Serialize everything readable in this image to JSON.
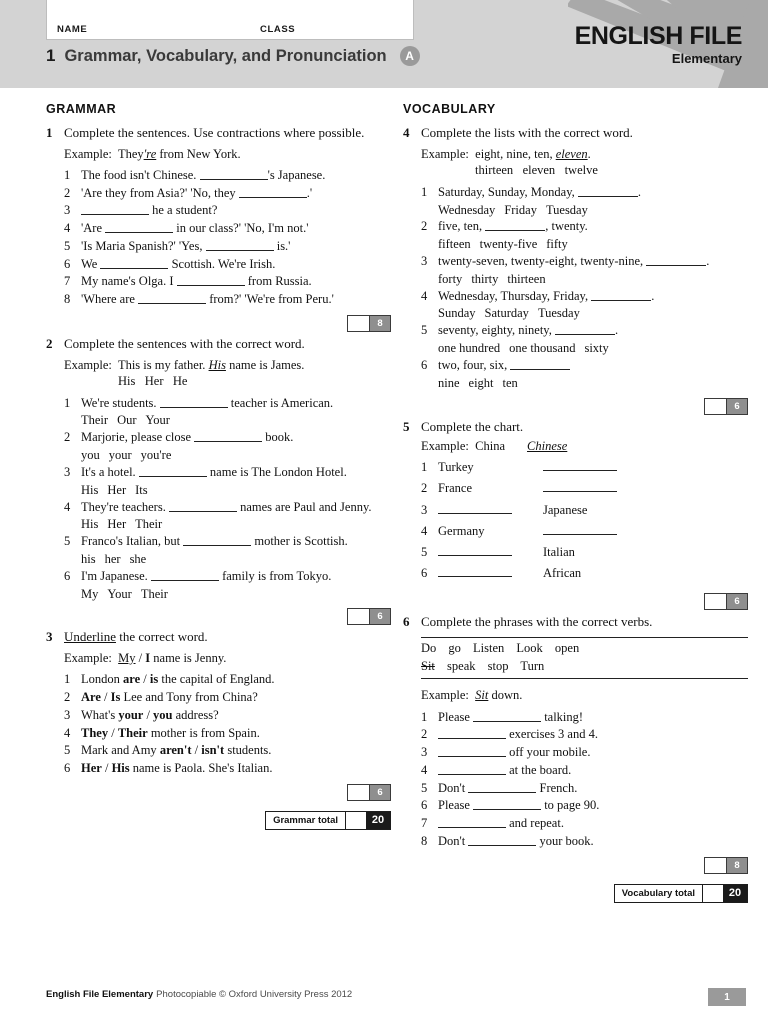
{
  "header": {
    "name_label": "NAME",
    "class_label": "CLASS",
    "unit_number": "1",
    "title": "Grammar, Vocabulary, and Pronunciation",
    "version_badge": "A",
    "brand_line1": "ENGLISH FILE",
    "brand_line2": "Elementary",
    "colors": {
      "header_bg": "#d3d3d3",
      "ray": "#a9a9a9",
      "badge": "#9a9a9a"
    }
  },
  "grammar": {
    "section_label": "GRAMMAR",
    "total_label": "Grammar total",
    "total_value": "20",
    "exercises": [
      {
        "number": "1",
        "instruction": "Complete the sentences. Use contractions where possible.",
        "example_lead": "Example:",
        "example_pre": "They",
        "example_answer": "'re",
        "example_post": " from New York.",
        "score": "8",
        "items": [
          {
            "n": "1",
            "pre": "The food isn't Chinese. ",
            "post": "'s Japanese."
          },
          {
            "n": "2",
            "pre": "'Are they from Asia?'    'No, they ",
            "post": ".'"
          },
          {
            "n": "3",
            "pre": "",
            "post": " he a student?"
          },
          {
            "n": "4",
            "pre": "'Are ",
            "post": " in our class?'    'No, I'm not.'"
          },
          {
            "n": "5",
            "pre": "'Is Maria Spanish?'    'Yes, ",
            "post": " is.'"
          },
          {
            "n": "6",
            "pre": "We ",
            "post": " Scottish. We're Irish."
          },
          {
            "n": "7",
            "pre": "My name's Olga. I ",
            "post": " from Russia."
          },
          {
            "n": "8",
            "pre": "'Where are ",
            "post": " from?'    'We're from Peru.'"
          }
        ]
      },
      {
        "number": "2",
        "instruction": "Complete the sentences with the correct word.",
        "example_lead": "Example:",
        "example_pre": "This is my father. ",
        "example_answer": "His",
        "example_post": " name is James.",
        "example_options": [
          "His",
          "Her",
          "He"
        ],
        "score": "6",
        "items": [
          {
            "n": "1",
            "pre": "We're students. ",
            "post": " teacher is American.",
            "options": [
              "Their",
              "Our",
              "Your"
            ]
          },
          {
            "n": "2",
            "pre": "Marjorie, please close ",
            "post": " book.",
            "options": [
              "you",
              "your",
              "you're"
            ]
          },
          {
            "n": "3",
            "pre": "It's a hotel. ",
            "post": " name is The London Hotel.",
            "options": [
              "His",
              "Her",
              "Its"
            ]
          },
          {
            "n": "4",
            "pre": "They're teachers. ",
            "post": " names are Paul and Jenny.",
            "options": [
              "His",
              "Her",
              "Their"
            ]
          },
          {
            "n": "5",
            "pre": "Franco's Italian, but ",
            "post": " mother is Scottish.",
            "options": [
              "his",
              "her",
              "she"
            ]
          },
          {
            "n": "6",
            "pre": "I'm Japanese. ",
            "post": " family is from Tokyo.",
            "options": [
              "My",
              "Your",
              "Their"
            ]
          }
        ]
      },
      {
        "number": "3",
        "instruction_underlined": "Underline",
        "instruction_rest": " the correct word.",
        "example_lead": "Example:",
        "example_answer": "My",
        "example_alt": "I",
        "example_post": " name is Jenny.",
        "score": "6",
        "items": [
          {
            "n": "1",
            "pre": "London ",
            "a": "are",
            "b": "is",
            "post": " the capital of England."
          },
          {
            "n": "2",
            "pre": "",
            "a": "Are",
            "b": "Is",
            "post": " Lee and Tony from China?"
          },
          {
            "n": "3",
            "pre": "What's ",
            "a": "your",
            "b": "you",
            "post": " address?"
          },
          {
            "n": "4",
            "pre": "",
            "a": "They",
            "b": "Their",
            "post": " mother is from Spain."
          },
          {
            "n": "5",
            "pre": "Mark and Amy ",
            "a": "aren't",
            "b": "isn't",
            "post": " students."
          },
          {
            "n": "6",
            "pre": "",
            "a": "Her",
            "b": "His",
            "post": " name is Paola. She's Italian."
          }
        ]
      }
    ]
  },
  "vocabulary": {
    "section_label": "VOCABULARY",
    "total_label": "Vocabulary total",
    "total_value": "20",
    "exercises": [
      {
        "number": "4",
        "instruction": "Complete the lists with the correct word.",
        "example_lead": "Example:",
        "example_pre": "eight, nine, ten, ",
        "example_answer": "eleven",
        "example_post": ".",
        "example_options": [
          "thirteen",
          "eleven",
          "twelve"
        ],
        "score": "6",
        "items": [
          {
            "n": "1",
            "pre": "Saturday, Sunday, Monday, ",
            "post": ".",
            "options": [
              "Wednesday",
              "Friday",
              "Tuesday"
            ]
          },
          {
            "n": "2",
            "pre": "five, ten, ",
            "post": ", twenty.",
            "options": [
              "fifteen",
              "twenty-five",
              "fifty"
            ]
          },
          {
            "n": "3",
            "pre": "twenty-seven, twenty-eight, twenty-nine, ",
            "post": ".",
            "options": [
              "forty",
              "thirty",
              "thirteen"
            ]
          },
          {
            "n": "4",
            "pre": "Wednesday, Thursday, Friday, ",
            "post": ".",
            "options": [
              "Sunday",
              "Saturday",
              "Tuesday"
            ]
          },
          {
            "n": "5",
            "pre": "seventy, eighty, ninety, ",
            "post": ".",
            "options": [
              "one hundred",
              "one thousand",
              "sixty"
            ]
          },
          {
            "n": "6",
            "pre": "two, four, six, ",
            "post": "",
            "options": [
              "nine",
              "eight",
              "ten"
            ]
          }
        ]
      },
      {
        "number": "5",
        "instruction": "Complete the chart.",
        "example_lead": "Example:",
        "example_country": "China",
        "example_nationality": "Chinese",
        "score": "6",
        "rows": [
          {
            "n": "1",
            "country": "Turkey",
            "nationality": ""
          },
          {
            "n": "2",
            "country": "France",
            "nationality": ""
          },
          {
            "n": "3",
            "country": "",
            "nationality": "Japanese"
          },
          {
            "n": "4",
            "country": "Germany",
            "nationality": ""
          },
          {
            "n": "5",
            "country": "",
            "nationality": "Italian"
          },
          {
            "n": "6",
            "country": "",
            "nationality": "African"
          }
        ]
      },
      {
        "number": "6",
        "instruction": "Complete the phrases with the correct verbs.",
        "word_bank_row1": [
          "Do",
          "go",
          "Listen",
          "Look",
          "open"
        ],
        "word_bank_row2_struck": "Sit",
        "word_bank_row2": [
          "speak",
          "stop",
          "Turn"
        ],
        "example_lead": "Example:",
        "example_answer": "Sit",
        "example_post": " down.",
        "score": "8",
        "items": [
          {
            "n": "1",
            "pre": "Please ",
            "post": " talking!"
          },
          {
            "n": "2",
            "pre": "",
            "post": " exercises 3 and 4."
          },
          {
            "n": "3",
            "pre": "",
            "post": " off your mobile."
          },
          {
            "n": "4",
            "pre": "",
            "post": " at the board."
          },
          {
            "n": "5",
            "pre": "Don't ",
            "post": " French."
          },
          {
            "n": "6",
            "pre": "Please ",
            "post": " to page 90."
          },
          {
            "n": "7",
            "pre": "",
            "post": " and repeat."
          },
          {
            "n": "8",
            "pre": "Don't ",
            "post": " your book."
          }
        ]
      }
    ]
  },
  "footer": {
    "brand": "English File Elementary",
    "copyright": "Photocopiable © Oxford University Press 2012",
    "page_number": "1"
  }
}
